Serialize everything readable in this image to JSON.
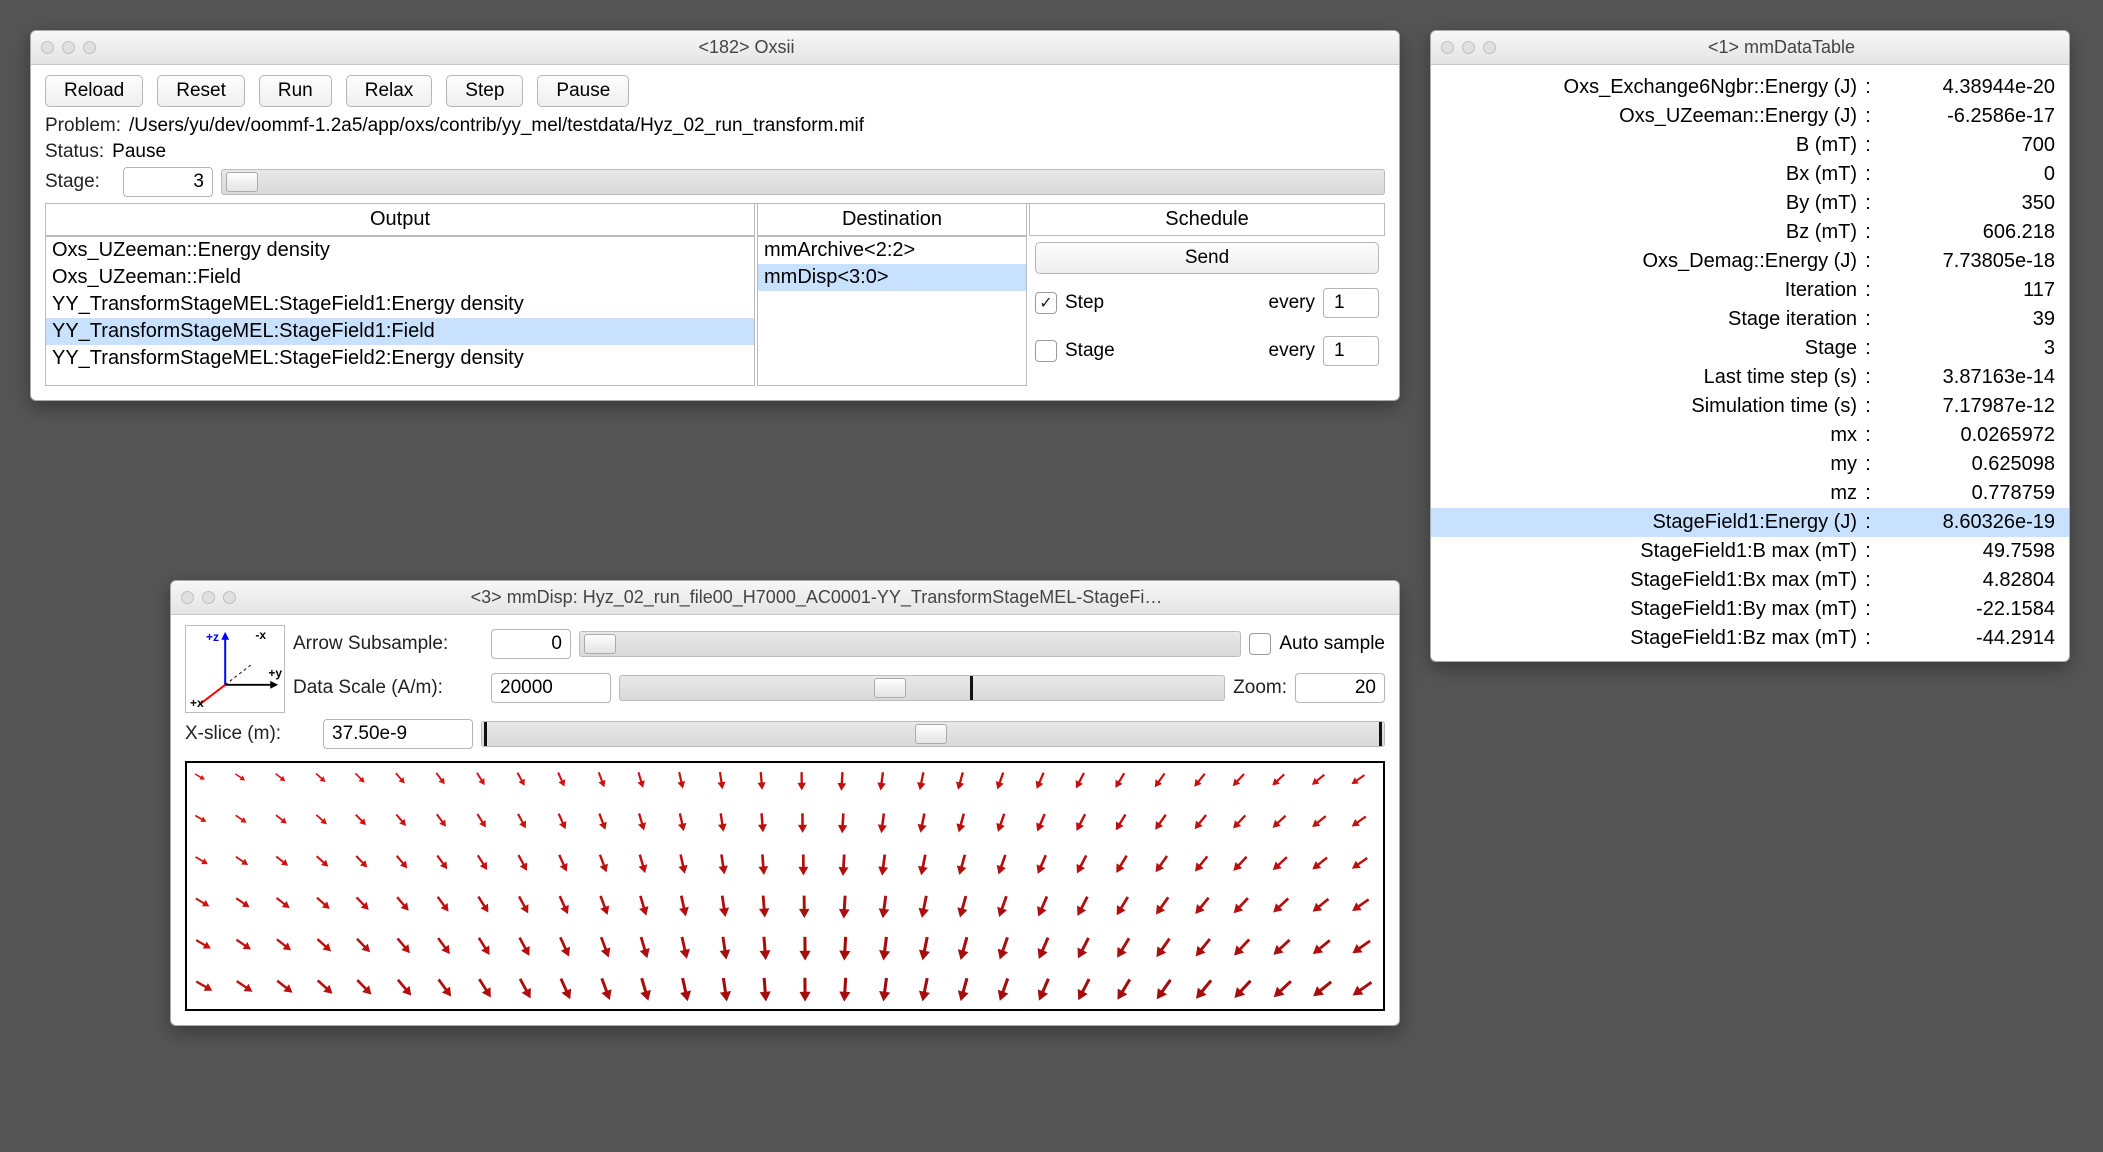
{
  "oxsii": {
    "title": "<182> Oxsii",
    "buttons": {
      "reload": "Reload",
      "reset": "Reset",
      "run": "Run",
      "relax": "Relax",
      "step": "Step",
      "pause": "Pause"
    },
    "problem_label": "Problem:",
    "problem_value": "/Users/yu/dev/oommf-1.2a5/app/oxs/contrib/yy_mel/testdata/Hyz_02_run_transform.mif",
    "status_label": "Status:",
    "status_value": "Pause",
    "stage_label": "Stage:",
    "stage_value": "3",
    "columns": {
      "output": "Output",
      "destination": "Destination",
      "schedule": "Schedule"
    },
    "outputs": {
      "items": [
        "Oxs_UZeeman::Energy density",
        "Oxs_UZeeman::Field",
        "YY_TransformStageMEL:StageField1:Energy density",
        "YY_TransformStageMEL:StageField1:Field",
        "YY_TransformStageMEL:StageField2:Energy density"
      ],
      "selected_index": 3
    },
    "destinations": {
      "items": [
        "mmArchive<2:2>",
        "mmDisp<3:0>"
      ],
      "selected_index": 1
    },
    "schedule": {
      "send_label": "Send",
      "step_label": "Step",
      "step_checked": true,
      "stage_label": "Stage",
      "stage_checked": false,
      "every_label": "every",
      "step_every": "1",
      "stage_every": "1"
    }
  },
  "mmdisp": {
    "title": "<3> mmDisp: Hyz_02_run_file00_H7000_AC0001-YY_TransformStageMEL-StageFi…",
    "arrow_subsample_label": "Arrow Subsample:",
    "arrow_subsample_value": "0",
    "auto_sample_label": "Auto sample",
    "auto_sample_checked": false,
    "data_scale_label": "Data Scale (A/m):",
    "data_scale_value": "20000",
    "zoom_label": "Zoom:",
    "zoom_value": "20",
    "xslice_label": "X-slice (m):",
    "xslice_value": "37.50e-9",
    "axis_labels": {
      "pz": "+z",
      "py": "+y",
      "px": "+x",
      "mx": "-x"
    }
  },
  "datatable": {
    "title": "<1> mmDataTable",
    "rows": [
      {
        "k": "Oxs_Exchange6Ngbr::Energy (J)",
        "v": "4.38944e-20",
        "sel": false
      },
      {
        "k": "Oxs_UZeeman::Energy (J)",
        "v": "-6.2586e-17",
        "sel": false
      },
      {
        "k": "B (mT)",
        "v": "700",
        "sel": false
      },
      {
        "k": "Bx (mT)",
        "v": "0",
        "sel": false
      },
      {
        "k": "By (mT)",
        "v": "350",
        "sel": false
      },
      {
        "k": "Bz (mT)",
        "v": "606.218",
        "sel": false
      },
      {
        "k": "Oxs_Demag::Energy (J)",
        "v": "7.73805e-18",
        "sel": false
      },
      {
        "k": "Iteration",
        "v": "117",
        "sel": false
      },
      {
        "k": "Stage iteration",
        "v": "39",
        "sel": false
      },
      {
        "k": "Stage",
        "v": "3",
        "sel": false
      },
      {
        "k": "Last time step (s)",
        "v": "3.87163e-14",
        "sel": false
      },
      {
        "k": "Simulation time (s)",
        "v": "7.17987e-12",
        "sel": false
      },
      {
        "k": "mx",
        "v": "0.0265972",
        "sel": false
      },
      {
        "k": "my",
        "v": "0.625098",
        "sel": false
      },
      {
        "k": "mz",
        "v": "0.778759",
        "sel": false
      },
      {
        "k": "StageField1:Energy (J)",
        "v": "8.60326e-19",
        "sel": true
      },
      {
        "k": "StageField1:B max (mT)",
        "v": "49.7598",
        "sel": false
      },
      {
        "k": "StageField1:Bx max (mT)",
        "v": "4.82804",
        "sel": false
      },
      {
        "k": "StageField1:By max (mT)",
        "v": "-22.1584",
        "sel": false
      },
      {
        "k": "StageField1:Bz max (mT)",
        "v": "-44.2914",
        "sel": false
      }
    ]
  },
  "chart_data": {
    "type": "vector-field",
    "description": "2D vector field slice. Arrows rotate from ~135deg (down-right tilt) on the left through ~180deg (straight down) near center to ~225deg (down-left tilt) on the right. Magnitude grows from short (top-left) to long (bottom-right) and center.",
    "grid": {
      "cols": 30,
      "rows": 6
    },
    "angle_deg_range": [
      120,
      235
    ],
    "magnitude_range": [
      0.25,
      1.0
    ],
    "color_map": "dark-red short → bright-red long"
  }
}
